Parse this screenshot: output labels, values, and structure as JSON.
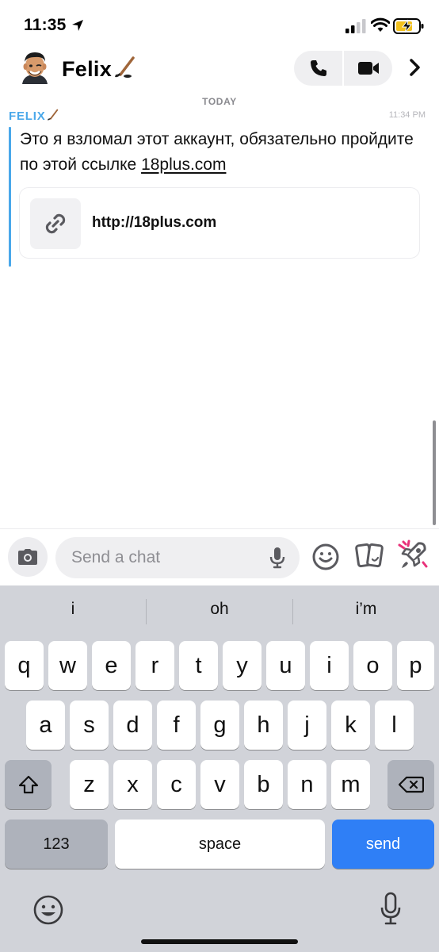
{
  "status_bar": {
    "time": "11:35",
    "icons": [
      "location-arrow-icon",
      "cellular-signal-icon",
      "wifi-icon",
      "battery-charging-icon"
    ]
  },
  "header": {
    "contact_name": "Felix",
    "name_emoji": "ice-hockey-stick-icon",
    "avatar": "bitmoji-avatar",
    "buttons": [
      "phone-icon",
      "video-camera-icon",
      "chevron-right-icon"
    ]
  },
  "chat": {
    "day_label": "TODAY",
    "messages": [
      {
        "sender": "FELIX",
        "time": "11:34 PM",
        "text": "Это я взломал этот аккаунт, обязательно пройдите по этой ссылке ",
        "link_text": "18plus.com",
        "link_preview": {
          "url": "http://18plus.com",
          "icon": "chain-link-icon"
        }
      }
    ]
  },
  "input_bar": {
    "placeholder": "Send a chat",
    "icons": [
      "camera-icon",
      "microphone-icon",
      "smiley-icon",
      "cards-icon",
      "rocket-sticker-icon"
    ]
  },
  "keyboard": {
    "suggestions": [
      "i",
      "oh",
      "i’m"
    ],
    "row1": [
      "q",
      "w",
      "e",
      "r",
      "t",
      "y",
      "u",
      "i",
      "o",
      "p"
    ],
    "row2": [
      "a",
      "s",
      "d",
      "f",
      "g",
      "h",
      "j",
      "k",
      "l"
    ],
    "row3": [
      "z",
      "x",
      "c",
      "v",
      "b",
      "n",
      "m"
    ],
    "numbers_label": "123",
    "space_label": "space",
    "send_label": "send",
    "colors": {
      "send": "#2f7ff6",
      "background": "#d1d3d9"
    }
  },
  "colors": {
    "accent": "#4aa8ea"
  }
}
